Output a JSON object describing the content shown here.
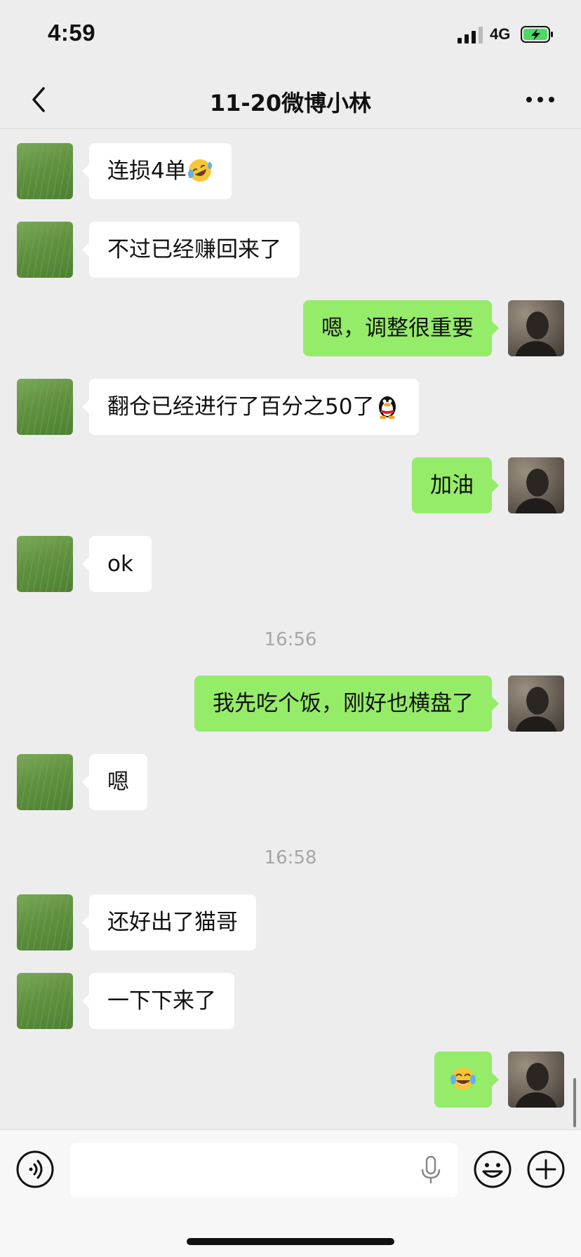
{
  "status_bar": {
    "time": "4:59",
    "network": "4G",
    "battery_state": "charging"
  },
  "nav": {
    "title": "11-20微博小林",
    "back_icon": "chevron-left-icon",
    "more_icon": "ellipsis-icon"
  },
  "messages": [
    {
      "side": "left",
      "text": "连损4单",
      "emoji": "rolling-on-floor-laughing"
    },
    {
      "side": "left",
      "text": "不过已经赚回来了"
    },
    {
      "side": "right",
      "text": "嗯，调整很重要"
    },
    {
      "side": "left",
      "text": "翻仓已经进行了百分之50了",
      "emoji": "penguin"
    },
    {
      "side": "right",
      "text": "加油"
    },
    {
      "side": "left",
      "text": "ok"
    },
    {
      "timestamp": "16:56"
    },
    {
      "side": "right",
      "text": "我先吃个饭，刚好也横盘了"
    },
    {
      "side": "left",
      "text": "嗯"
    },
    {
      "timestamp": "16:58"
    },
    {
      "side": "left",
      "text": "还好出了猫哥"
    },
    {
      "side": "left",
      "text": "一下下来了"
    },
    {
      "side": "right",
      "text": "",
      "emoji": "tears-of-joy"
    }
  ],
  "input_bar": {
    "placeholder": "",
    "value": ""
  },
  "colors": {
    "background": "#ededed",
    "bubble_self": "#95ec69",
    "bubble_other": "#ffffff",
    "timestamp": "#a6a6a6"
  }
}
